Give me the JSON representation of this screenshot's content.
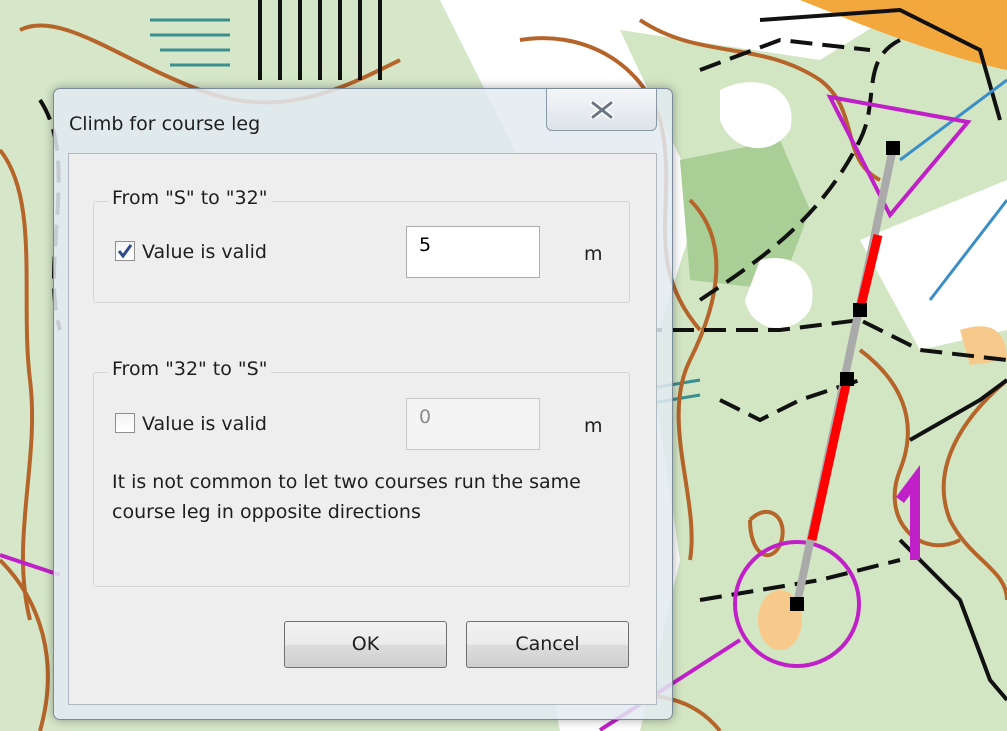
{
  "dialog": {
    "title": "Climb for course leg",
    "close_icon": "close-x-icon",
    "groups": [
      {
        "label": "From \"S\" to \"32\"",
        "checkbox_label": "Value is valid",
        "checked": true,
        "value": "5",
        "unit": "m",
        "enabled": true
      },
      {
        "label": "From \"32\" to \"S\"",
        "checkbox_label": "Value is valid",
        "checked": false,
        "value": "0",
        "unit": "m",
        "enabled": false,
        "note": "It is not common to let two courses run the same course leg in opposite directions"
      }
    ],
    "buttons": {
      "ok": "OK",
      "cancel": "Cancel"
    }
  },
  "map_colors": {
    "forest_green": "#cfe3c0",
    "contour_brown": "#b5652a",
    "course_magenta": "#c020c8",
    "leg_red": "#ff0000",
    "water_blue": "#3b8fc6",
    "open_orange": "#f2a83c"
  }
}
